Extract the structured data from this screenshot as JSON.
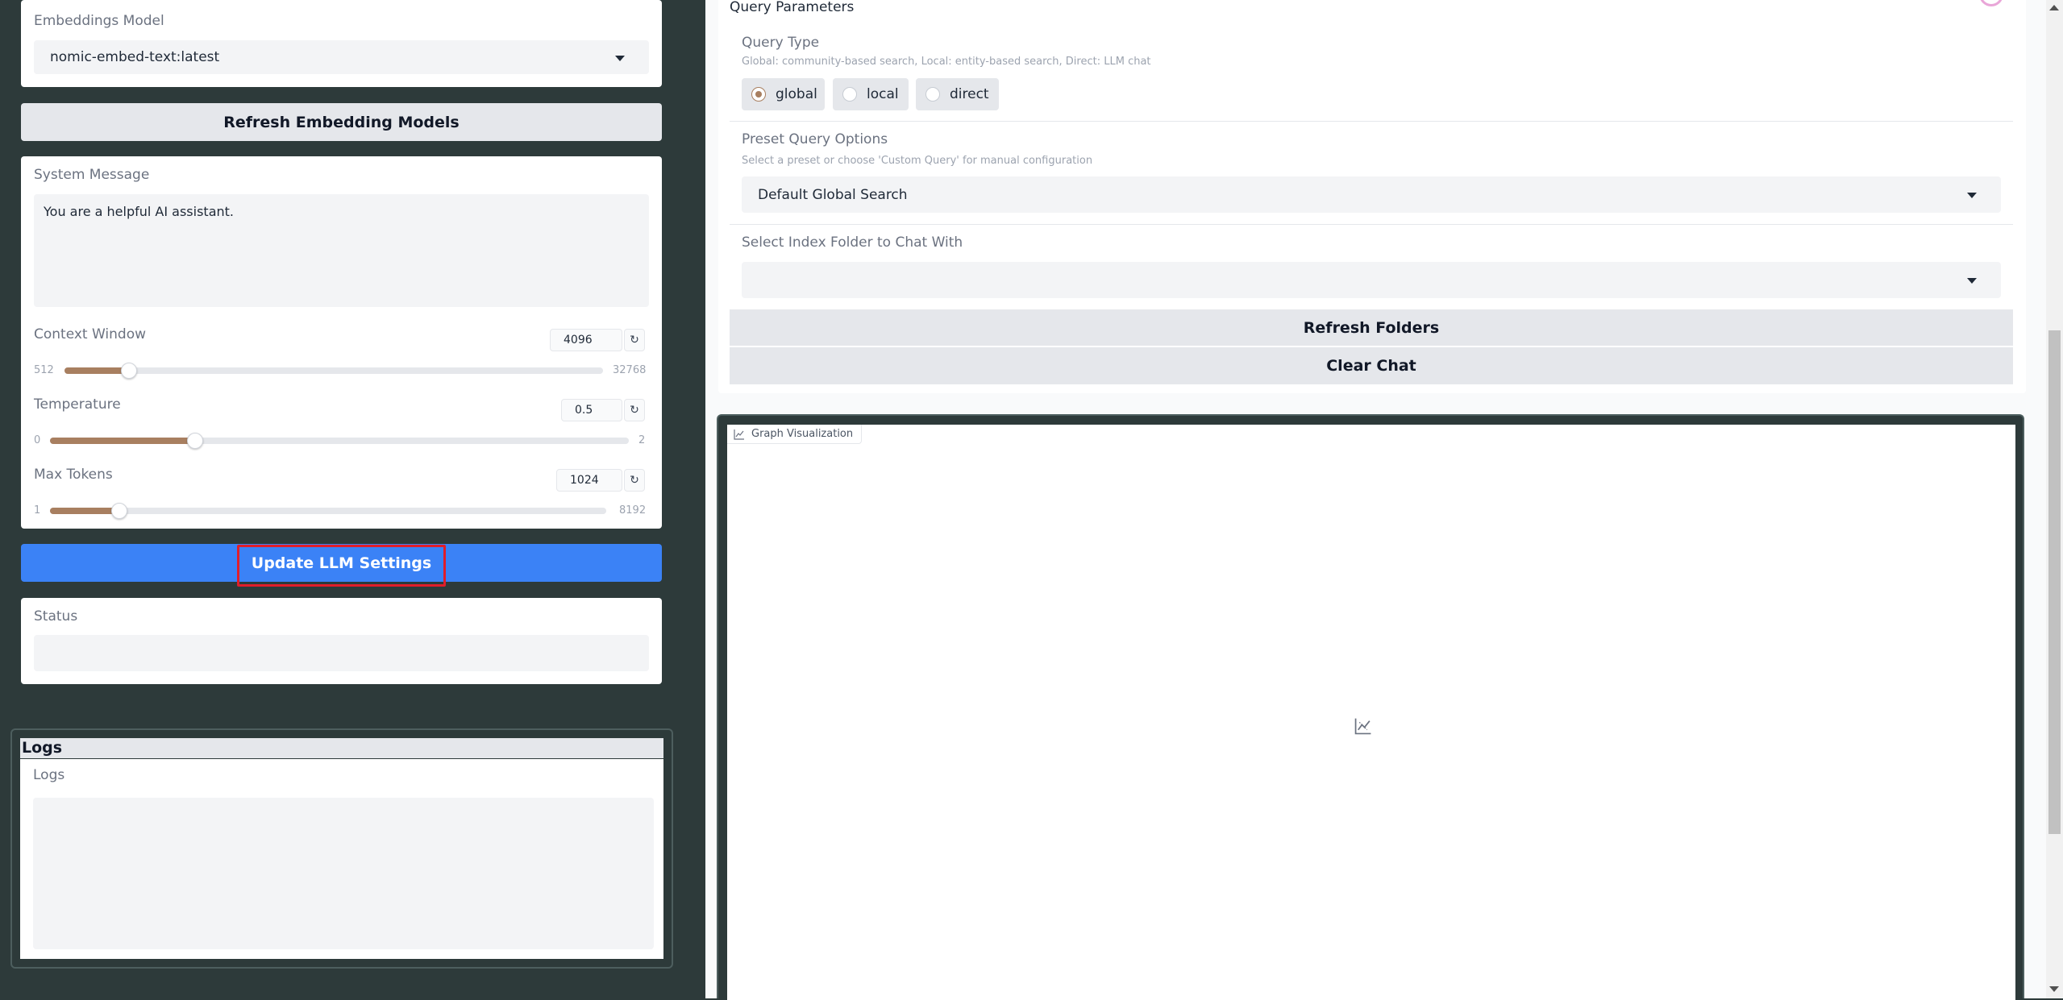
{
  "left": {
    "embeddings": {
      "label": "Embeddings Model",
      "value": "nomic-embed-text:latest"
    },
    "refresh_embedding_label": "Refresh Embedding Models",
    "system_message": {
      "label": "System Message",
      "value": "You are a helpful AI assistant."
    },
    "context_window": {
      "label": "Context Window",
      "value": "4096",
      "min": "512",
      "max": "32768",
      "fraction": 0.12
    },
    "temperature": {
      "label": "Temperature",
      "value": "0.5",
      "min": "0",
      "max": "2",
      "fraction": 0.25
    },
    "max_tokens": {
      "label": "Max Tokens",
      "value": "1024",
      "min": "1",
      "max": "8192",
      "fraction": 0.125
    },
    "update_button_label": "Update LLM Settings",
    "status": {
      "label": "Status",
      "value": ""
    },
    "logs": {
      "header": "Logs",
      "label": "Logs",
      "value": ""
    }
  },
  "right": {
    "section_title": "Query Parameters",
    "query_type": {
      "label": "Query Type",
      "hint": "Global: community-based search, Local: entity-based search, Direct: LLM chat",
      "options": [
        "global",
        "local",
        "direct"
      ],
      "selected": "global"
    },
    "preset": {
      "label": "Preset Query Options",
      "hint": "Select a preset or choose 'Custom Query' for manual configuration",
      "value": "Default Global Search"
    },
    "index_folder": {
      "label": "Select Index Folder to Chat With",
      "value": ""
    },
    "refresh_folders_label": "Refresh Folders",
    "clear_chat_label": "Clear Chat",
    "graph_tab_label": "Graph Visualization"
  },
  "colors": {
    "page_bg": "#2d3a3a",
    "accent": "#a87f60",
    "primary": "#3b82f6",
    "highlight": "#e11d2a"
  }
}
